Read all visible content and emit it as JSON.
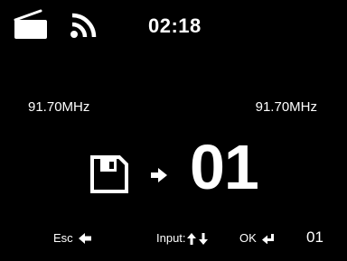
{
  "status_bar": {
    "source_icon": "radio-icon",
    "signal_icon": "wifi-signal-icon",
    "time": "02:18"
  },
  "frequency": {
    "current": "91.70MHz",
    "preset": "91.70MHz"
  },
  "save_row": {
    "save_icon": "floppy-disk-icon",
    "arrow_icon": "arrow-right-icon",
    "preset_number": "01"
  },
  "hints": {
    "esc_label": "Esc",
    "esc_icon": "arrow-left-icon",
    "input_label": "Input:",
    "input_icons": [
      "arrow-up-icon",
      "arrow-down-icon"
    ],
    "ok_label": "OK",
    "ok_icon": "enter-icon",
    "page": "01"
  },
  "colors": {
    "background": "#000000",
    "foreground": "#ffffff"
  }
}
